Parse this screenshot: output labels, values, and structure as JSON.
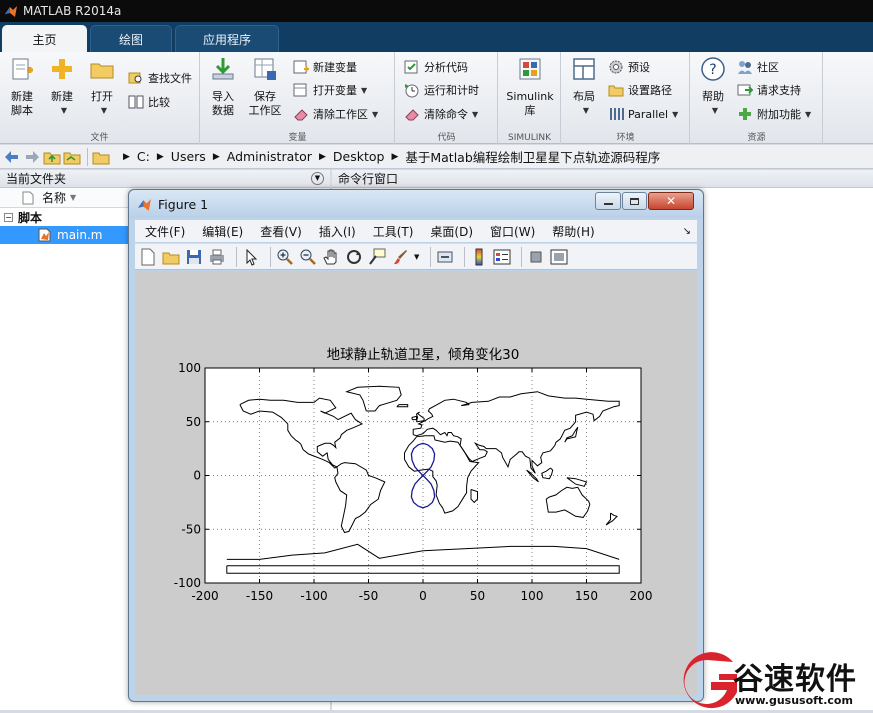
{
  "app": {
    "title": "MATLAB R2014a"
  },
  "tabs": [
    {
      "label": "主页",
      "active": true
    },
    {
      "label": "绘图",
      "active": false
    },
    {
      "label": "应用程序",
      "active": false
    }
  ],
  "ribbon": {
    "file": {
      "label": "文件",
      "new_script": "新建\n脚本",
      "new_script_l1": "新建",
      "new_script_l2": "脚本",
      "new": "新建",
      "open": "打开",
      "find_files": "查找文件",
      "compare": "比较"
    },
    "variable": {
      "label": "变量",
      "import_l1": "导入",
      "import_l2": "数据",
      "save_l1": "保存",
      "save_l2": "工作区",
      "new_var": "新建变量",
      "open_var": "打开变量",
      "clear_ws": "清除工作区"
    },
    "code": {
      "label": "代码",
      "analyze": "分析代码",
      "run_time": "运行和计时",
      "clear_cmd": "清除命令"
    },
    "simulink": {
      "label": "SIMULINK",
      "lib_l1": "Simulink",
      "lib_l2": "库"
    },
    "env": {
      "label": "环境",
      "layout": "布局",
      "prefs": "预设",
      "set_path": "设置路径",
      "parallel": "Parallel"
    },
    "resources": {
      "label": "资源",
      "help": "帮助",
      "community": "社区",
      "request_support": "请求支持",
      "addons": "附加功能"
    }
  },
  "address": {
    "path": [
      "C:",
      "Users",
      "Administrator",
      "Desktop",
      "基于Matlab编程绘制卫星星下点轨迹源码程序"
    ]
  },
  "current_folder": {
    "title": "当前文件夹",
    "column_name": "名称",
    "group": "脚本",
    "file": "main.m"
  },
  "command_window": {
    "title": "命令行窗口"
  },
  "figure": {
    "title": "Figure 1",
    "menu": [
      "文件(F)",
      "编辑(E)",
      "查看(V)",
      "插入(I)",
      "工具(T)",
      "桌面(D)",
      "窗口(W)",
      "帮助(H)"
    ]
  },
  "chart_data": {
    "type": "line",
    "title": "地球静止轨道卫星，倾角变化30",
    "xlabel": "",
    "ylabel": "",
    "xlim": [
      -200,
      200
    ],
    "ylim": [
      -100,
      100
    ],
    "xticks": [
      -200,
      -150,
      -100,
      -50,
      0,
      50,
      100,
      150,
      200
    ],
    "yticks": [
      -100,
      -50,
      0,
      50,
      100
    ],
    "grid": true,
    "grid_style": "dotted",
    "series": [
      {
        "name": "",
        "color": "#1a1a9a",
        "x": [
          0,
          3.9,
          7.4,
          10,
          10.6,
          8.6,
          4.5,
          0,
          -4.5,
          -8.6,
          -10.6,
          -10,
          -7.4,
          -3.9,
          0,
          3.9,
          7.4,
          10,
          10.6,
          8.6,
          4.5,
          0,
          -4.5,
          -8.6,
          -10.6,
          -10,
          -7.4,
          -3.9,
          0
        ],
        "y": [
          0,
          4,
          8,
          14,
          20,
          25,
          28.5,
          30,
          28.5,
          25,
          20,
          14,
          8,
          4,
          0,
          -4,
          -8,
          -14,
          -20,
          -25,
          -28.5,
          -30,
          -28.5,
          -25,
          -20,
          -14,
          -8,
          -4,
          0
        ]
      }
    ]
  },
  "watermark": {
    "brand": "谷速软件",
    "url": "www.gususoft.com",
    "color": "#d9232d"
  }
}
